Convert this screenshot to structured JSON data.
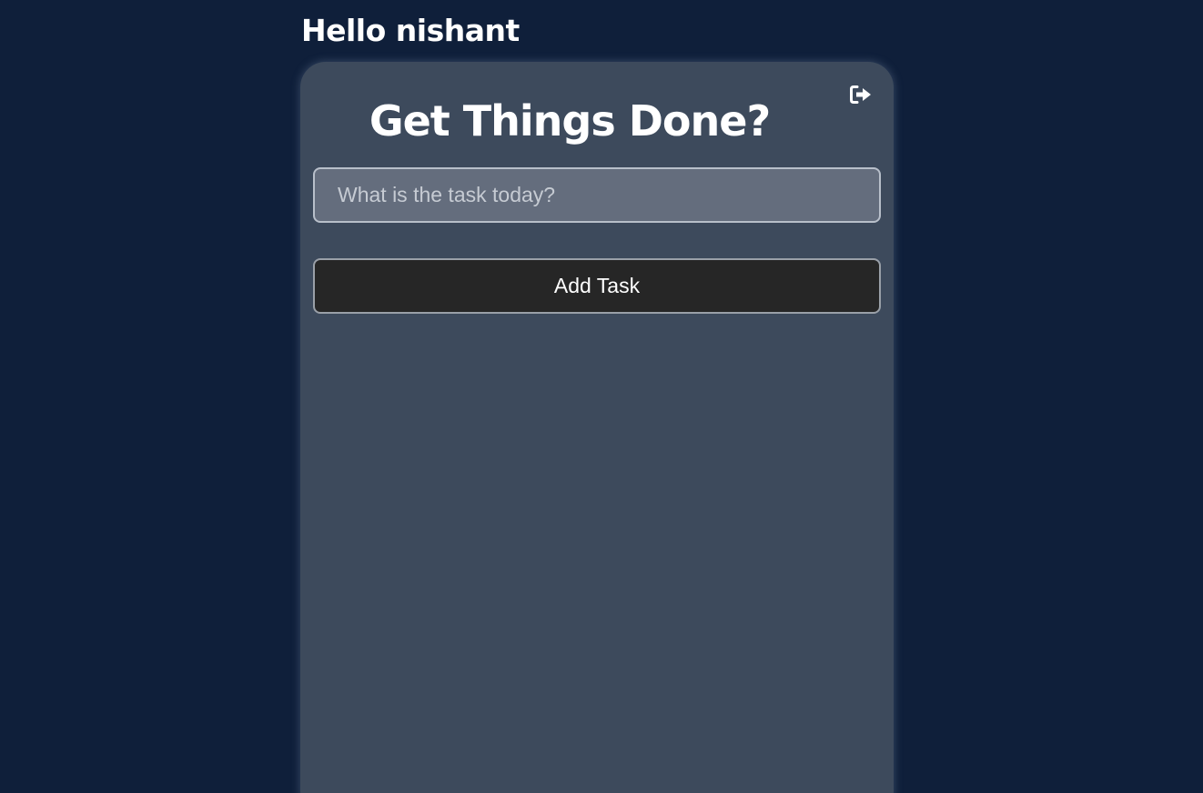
{
  "header": {
    "greeting": "Hello nishant"
  },
  "card": {
    "title": "Get Things Done?",
    "logout_icon": "sign-out-icon",
    "task_input": {
      "value": "",
      "placeholder": "What is the task today?"
    },
    "add_button_label": "Add Task"
  },
  "colors": {
    "page_background": "#0f1f3a",
    "card_background": "#3d4a5c",
    "input_background": "#646d7d",
    "button_background": "#262626",
    "text": "#ffffff"
  }
}
